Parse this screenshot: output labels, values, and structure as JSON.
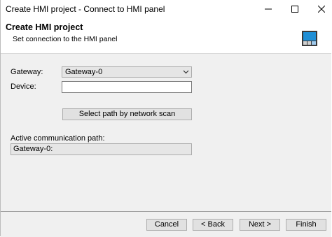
{
  "window": {
    "title": "Create HMI project - Connect to HMI panel"
  },
  "header": {
    "title": "Create HMI project",
    "subtitle": "Set connection to the HMI panel",
    "icon": "hmi-panel-icon"
  },
  "form": {
    "gateway_label": "Gateway:",
    "gateway_value": "Gateway-0",
    "device_label": "Device:",
    "device_value": "",
    "scan_button": "Select path by network scan",
    "path_label": "Active communication path:",
    "path_value": "Gateway-0:"
  },
  "footer": {
    "cancel": "Cancel",
    "back": "< Back",
    "next": "Next >",
    "finish": "Finish"
  },
  "colors": {
    "content_bg": "#f0f0f0",
    "button_bg": "#e1e1e1",
    "icon_blue": "#1f8fd6"
  }
}
